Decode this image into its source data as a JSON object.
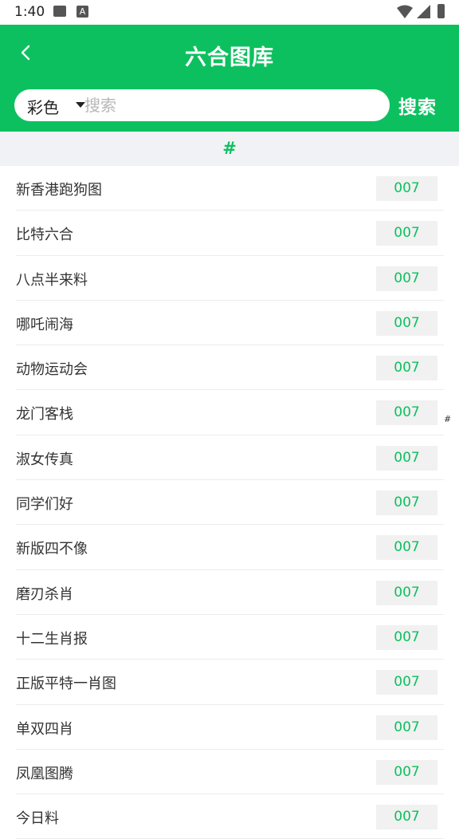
{
  "status_bar": {
    "time": "1:40",
    "a_icon": "A"
  },
  "header": {
    "title": "六合图库",
    "back_icon": "chevron-left-icon",
    "background_color": "#0dc05f"
  },
  "search": {
    "filter_value": "彩色",
    "placeholder": "搜索",
    "button_label": "搜索"
  },
  "section": {
    "label": "#"
  },
  "index_bar": {
    "label": "#"
  },
  "items": [
    {
      "title": "新香港跑狗图",
      "badge": "007"
    },
    {
      "title": "比特六合",
      "badge": "007"
    },
    {
      "title": "八点半来料",
      "badge": "007"
    },
    {
      "title": "哪吒闹海",
      "badge": "007"
    },
    {
      "title": "动物运动会",
      "badge": "007"
    },
    {
      "title": "龙门客栈",
      "badge": "007"
    },
    {
      "title": "淑女传真",
      "badge": "007"
    },
    {
      "title": "同学们好",
      "badge": "007"
    },
    {
      "title": "新版四不像",
      "badge": "007"
    },
    {
      "title": "磨刃杀肖",
      "badge": "007"
    },
    {
      "title": "十二生肖报",
      "badge": "007"
    },
    {
      "title": "正版平特一肖图",
      "badge": "007"
    },
    {
      "title": "单双四肖",
      "badge": "007"
    },
    {
      "title": "凤凰图腾",
      "badge": "007"
    },
    {
      "title": "今日料",
      "badge": "007"
    }
  ]
}
